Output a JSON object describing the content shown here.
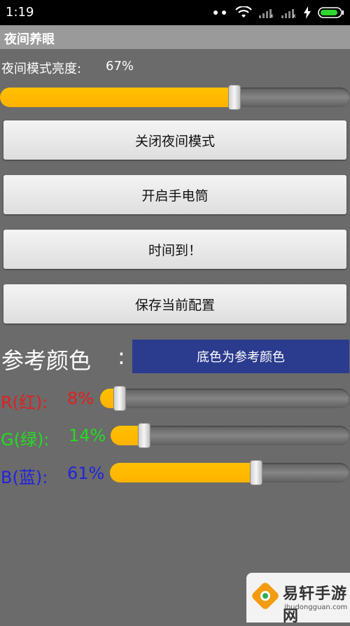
{
  "status_bar": {
    "time": "1:19",
    "icons": [
      "dots-icon",
      "wifi-icon",
      "signal-icon",
      "signal-icon",
      "charging-icon",
      "battery-icon"
    ]
  },
  "app": {
    "title": "夜间养眼"
  },
  "brightness": {
    "label": "夜间模式亮度:",
    "value_text": "67%",
    "level": 0.67
  },
  "buttons": {
    "close_night_mode": "关闭夜间模式",
    "open_flashlight": "开启手电筒",
    "time_up": "时间到！",
    "save_config": "保存当前配置"
  },
  "reference": {
    "label": "参考颜色",
    "colon": ":",
    "swatch_text": "底色为参考颜色",
    "swatch_color": "#2b3b8e"
  },
  "rgb": {
    "r": {
      "label": "R(红):",
      "value_text": "8%",
      "level": 0.08,
      "color": "#e02020"
    },
    "g": {
      "label": "G(绿):",
      "value_text": "14%",
      "level": 0.14,
      "color": "#22dd22"
    },
    "b": {
      "label": "B(蓝):",
      "value_text": "61%",
      "level": 0.61,
      "color": "#2222dd"
    }
  },
  "colors": {
    "accent": "#ffb300",
    "background": "#6b6b6b"
  },
  "watermark": {
    "text": "易轩手游网",
    "sub": "ibudongguan.com"
  }
}
